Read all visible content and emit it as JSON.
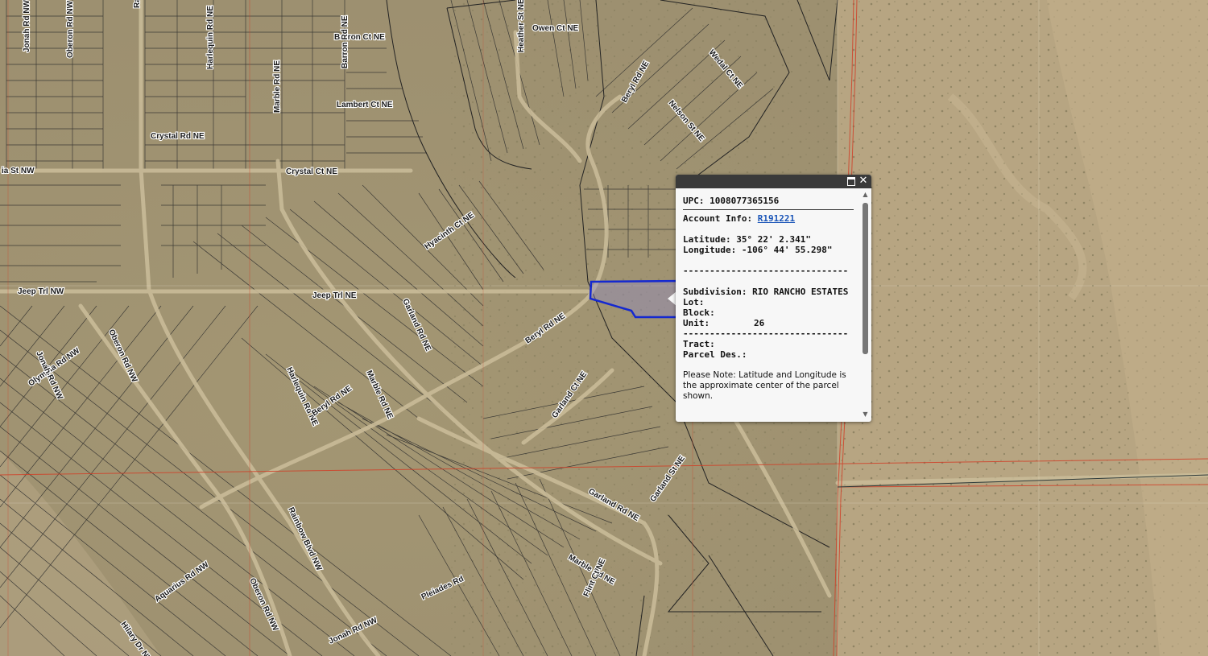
{
  "map": {
    "street_labels": [
      {
        "name": "street-label",
        "text": "Barron Ct NE"
      },
      {
        "name": "street-label",
        "text": "Owen Ct NE"
      },
      {
        "name": "street-label",
        "text": "Rainbow Blvd NW"
      },
      {
        "name": "street-label",
        "text": "Harlequin Rd NE"
      },
      {
        "name": "street-label",
        "text": "Marble Rd NE"
      },
      {
        "name": "street-label",
        "text": "Barron Rd NE"
      },
      {
        "name": "street-label",
        "text": "Lambert Ct NE"
      },
      {
        "name": "street-label",
        "text": "Crystal Rd NE"
      },
      {
        "name": "street-label",
        "text": "Crystal Ct NE"
      },
      {
        "name": "street-label",
        "text": "Heather St NE"
      },
      {
        "name": "street-label",
        "text": "Wedal Ct NE"
      },
      {
        "name": "street-label",
        "text": "Beryl Rd NE"
      },
      {
        "name": "street-label",
        "text": "Nelson St NE"
      },
      {
        "name": "street-label",
        "text": "Hyacinth Ct NE"
      },
      {
        "name": "street-label",
        "text": "Jeep Trl NE"
      },
      {
        "name": "street-label",
        "text": "Garland Rd NE"
      },
      {
        "name": "street-label",
        "text": "Beryl Rd NE"
      },
      {
        "name": "street-label",
        "text": "Marble Rd NE"
      },
      {
        "name": "street-label",
        "text": "Harlequin Rd NE"
      },
      {
        "name": "street-label",
        "text": "Olympia Rd NW"
      },
      {
        "name": "street-label",
        "text": "Jonah Rd NW"
      },
      {
        "name": "street-label",
        "text": "Oberon Rd NW"
      },
      {
        "name": "street-label",
        "text": "Beryl Rd NE"
      },
      {
        "name": "street-label",
        "text": "Garland Ct NE"
      },
      {
        "name": "street-label",
        "text": "Garland Rd NE"
      },
      {
        "name": "street-label",
        "text": "Garland St NE"
      },
      {
        "name": "street-label",
        "text": "Rainbow Blvd NW"
      },
      {
        "name": "street-label",
        "text": "Marble Rd NE"
      },
      {
        "name": "street-label",
        "text": "Flint Ct NE"
      },
      {
        "name": "street-label",
        "text": "Oberon Rd NW"
      },
      {
        "name": "street-label",
        "text": "Aquarius Rd NW"
      },
      {
        "name": "street-label",
        "text": "Hilary Dr NW"
      },
      {
        "name": "street-label",
        "text": "Pleiades Rd"
      },
      {
        "name": "street-label",
        "text": "Jonah Rd NW"
      },
      {
        "name": "street-label",
        "text": "Jeep Trl NW"
      },
      {
        "name": "street-label",
        "text": "ia St NW"
      },
      {
        "name": "street-label",
        "text": "Oberon Rd NW"
      },
      {
        "name": "street-label",
        "text": "Jonah Rd NW"
      }
    ]
  },
  "popup": {
    "upc_label": "UPC:",
    "upc_value": "1008077365156",
    "account_label": "Account Info:",
    "account_value": "R191221",
    "latitude_label": "Latitude:",
    "latitude_value": "35° 22' 2.341\"",
    "longitude_label": "Longitude:",
    "longitude_value": "-106° 44' 55.298\"",
    "divider": "-------------------------------",
    "subdivision_label": "Subdivision:",
    "subdivision_value": "RIO RANCHO ESTATES",
    "lot_label": "Lot:",
    "lot_value": "",
    "block_label": "Block:",
    "block_value": "",
    "unit_label": "Unit:",
    "unit_value": "26",
    "tract_label": "Tract:",
    "tract_value": "",
    "parcel_label": "Parcel Des.:",
    "parcel_value": "",
    "note": "Please Note: Latitude and Longitude is the approximate center of the parcel shown."
  },
  "colors": {
    "parcel_highlight": "#1428d0",
    "section_line": "#d23a22",
    "parcel_line": "#2a2a2a"
  }
}
